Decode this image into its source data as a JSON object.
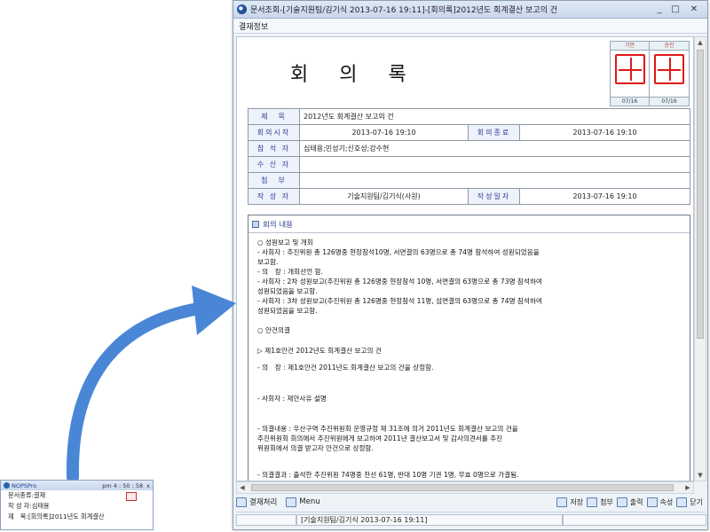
{
  "window": {
    "title": "문서조회-[기술지원팀/김기식 2013-07-16 19:11]-[회의록]2012년도 회계결산 보고의 건",
    "minimize": "_",
    "maximize": "□",
    "close": "✕"
  },
  "menu": {
    "item": "결재정보"
  },
  "doc": {
    "title": "회 의 록",
    "approval": {
      "col1_label": "기안",
      "col2_label": "승인",
      "col1_date": "07/16",
      "col2_date": "07/16",
      "stamp_color": "#e01818"
    },
    "info": {
      "subject_label": "제　목",
      "subject": "2012년도 회계결산 보고의 건",
      "start_label": "회의시작",
      "start": "2013-07-16 19:10",
      "end_label": "회의종료",
      "end": "2013-07-16 19:10",
      "attendees_label": "참 석 자",
      "attendees": "심태용;민성기;신호성;강수현",
      "recipients_label": "수 신 자",
      "recipients": "",
      "attach_label": "첨　부",
      "attach": "",
      "author_label": "작 성 자",
      "author": "기술지원팀/김기식(사원)",
      "date_label": "작성일자",
      "date": "2013-07-16 19:10"
    },
    "content": {
      "heading": "회의 내용",
      "lines": [
        "○  성원보고 및 개회",
        "  - 사회자 : 추진위원 총 126명중 현장참석10명, 서면결의 63명으로 총 74명 참석하여 성원되었음을",
        "                보고함.",
        "  - 의　장 : 개회선언 함.",
        "  - 사회자 : 2차 성원보고(추진위원 총 126명중 현장참석 10명, 서면결의 63명으로 총 73명 참석하여",
        "                성원되었음을 보고함.",
        "  - 사회자 : 3차 성원보고(추진위원 총 126명중 현장참석 11명, 섬면결의 63명으로 총 74명 참석하여",
        "                성원되었음을 보고함.",
        "○  안건의결",
        "  ▷ 제1호안건 2012년도 회계결산 보고의 건",
        "  - 의　장 : 제1호안건 2011년도 회계결산 보고의 건을 상정함.",
        "  - 사회자 : 제안사유 설명",
        "  - 의결내용 :  우산구역 추진위원회 운영규정 제 31조에 의거 2011년도 회계결산 보고의 건을",
        "                     추진위원회 회의에서 추진위원에게 보고하여 2011년 결산보고서 및 감사의견서를 추진",
        "                     위원회에서 의결 받고자 안건으로 상정함.",
        "  - 의결결과 :  출석한 추진위원 74명중 찬선 61명, 반대 10명 기권 1명, 무효 0명으로 가결됨."
      ]
    }
  },
  "toolbar": {
    "approve": "결재처리",
    "menu": "Menu",
    "save": "저장",
    "attach": "첨부",
    "print": "출력",
    "props": "속성",
    "close": "닫기"
  },
  "status": {
    "text": "[기술지원팀/김기식 2013-07-16 19:11]"
  },
  "notify": {
    "app": "NOPSPro",
    "time": "pm  4 : 50 : 58",
    "close": "x",
    "line1": "문서종류:결재",
    "line2": "작 성 자:심태용",
    "line3": "제　목:[회의록]2011년도 회계결산"
  },
  "colors": {
    "arrow": "#4a86d6",
    "label_text": "#2b3f94"
  }
}
